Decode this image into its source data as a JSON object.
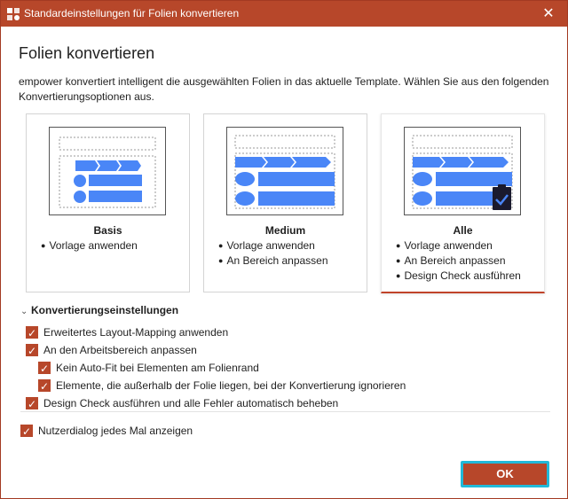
{
  "window": {
    "title": "Standardeinstellungen für Folien konvertieren",
    "close_glyph": "✕",
    "app_icon": "powerpoint-logo-icon"
  },
  "main": {
    "heading": "Folien konvertieren",
    "description": "empower konvertiert intelligent die ausgewählten Folien in das aktuelle Template. Wählen Sie aus den folgenden Konvertierungsoptionen aus."
  },
  "options": [
    {
      "title": "Basis",
      "items": [
        "Vorlage anwenden"
      ],
      "selected": false
    },
    {
      "title": "Medium",
      "items": [
        "Vorlage anwenden",
        "An Bereich anpassen"
      ],
      "selected": false
    },
    {
      "title": "Alle",
      "items": [
        "Vorlage anwenden",
        "An Bereich anpassen",
        "Design Check ausführen"
      ],
      "selected": true
    }
  ],
  "settings": {
    "header": "Konvertierungseinstellungen",
    "checkboxes": [
      {
        "label": "Erweitertes Layout-Mapping anwenden",
        "checked": true
      },
      {
        "label": "An den Arbeitsbereich anpassen",
        "checked": true
      },
      {
        "label": "Kein Auto-Fit bei Elementen am Folienrand",
        "checked": true
      },
      {
        "label": "Elemente, die außerhalb der Folie liegen, bei der Konvertierung ignorieren",
        "checked": true
      },
      {
        "label": "Design Check ausführen und alle Fehler automatisch beheben",
        "checked": true
      }
    ],
    "dialog_checkbox": {
      "label": "Nutzerdialog jedes Mal anzeigen",
      "checked": true
    }
  },
  "footer": {
    "ok_label": "OK"
  },
  "colors": {
    "accent": "#b7472a",
    "shape_blue": "#4a86f7",
    "focus": "#21b9d8"
  }
}
